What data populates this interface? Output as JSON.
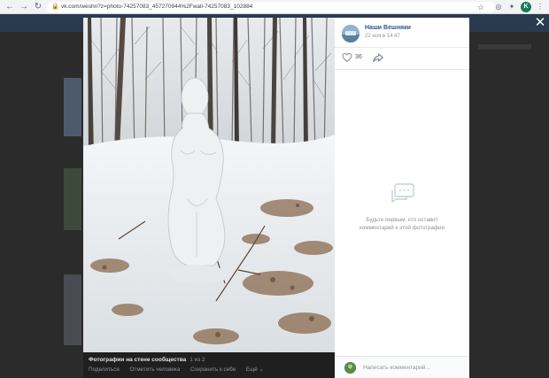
{
  "browser": {
    "url": "vk.com/weshn?z=photo-74257083_457270944%2Fwall-74257083_102884",
    "profile_initial": "K"
  },
  "viewer": {
    "album_title": "Фотографии на стене сообщества",
    "photo_count": "1 из 2",
    "actions": [
      "Поделиться",
      "Отметить человека",
      "Сохранить к себе",
      "Ещё ⌄"
    ]
  },
  "post": {
    "group_name": "Наши Вешняки",
    "date": "22 ноя в 14:47",
    "likes": "36"
  },
  "comments": {
    "empty_text": "Будьте первым, кто оставит комментарий к этой фотографии",
    "input_placeholder": "Написать комментарий..."
  },
  "colors": {
    "link": "#2a5885",
    "muted": "#939393"
  }
}
